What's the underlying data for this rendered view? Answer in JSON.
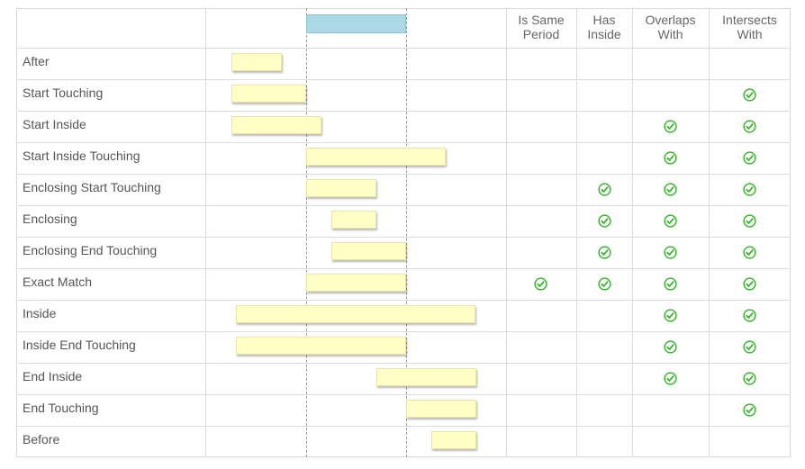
{
  "columns": [
    {
      "label_line1": "Is Same",
      "label_line2": "Period"
    },
    {
      "label_line1": "Has",
      "label_line2": "Inside"
    },
    {
      "label_line1": "Overlaps",
      "label_line2": "With"
    },
    {
      "label_line1": "Intersects",
      "label_line2": "With"
    }
  ],
  "rows": [
    {
      "label": "After",
      "checks": [
        false,
        false,
        false,
        false
      ]
    },
    {
      "label": "Start Touching",
      "checks": [
        false,
        false,
        false,
        true
      ]
    },
    {
      "label": "Start Inside",
      "checks": [
        false,
        false,
        true,
        true
      ]
    },
    {
      "label": "Start Inside Touching",
      "checks": [
        false,
        false,
        true,
        true
      ]
    },
    {
      "label": "Enclosing Start Touching",
      "checks": [
        false,
        true,
        true,
        true
      ]
    },
    {
      "label": "Enclosing",
      "checks": [
        false,
        true,
        true,
        true
      ]
    },
    {
      "label": "Enclosing End Touching",
      "checks": [
        false,
        true,
        true,
        true
      ]
    },
    {
      "label": "Exact Match",
      "checks": [
        true,
        true,
        true,
        true
      ]
    },
    {
      "label": "Inside",
      "checks": [
        false,
        false,
        true,
        true
      ]
    },
    {
      "label": "Inside End Touching",
      "checks": [
        false,
        false,
        true,
        true
      ]
    },
    {
      "label": "End Inside",
      "checks": [
        false,
        false,
        true,
        true
      ]
    },
    {
      "label": "End Touching",
      "checks": [
        false,
        false,
        false,
        true
      ]
    },
    {
      "label": "Before",
      "checks": [
        false,
        false,
        false,
        false
      ]
    }
  ],
  "reference_period": {
    "start": 0,
    "end": 10
  },
  "periods": [
    {
      "start": -7.5,
      "end": -2.5
    },
    {
      "start": -7.5,
      "end": 0
    },
    {
      "start": -7.5,
      "end": 1.5
    },
    {
      "start": 0,
      "end": 14
    },
    {
      "start": 0,
      "end": 7
    },
    {
      "start": 2.5,
      "end": 7
    },
    {
      "start": 2.5,
      "end": 10
    },
    {
      "start": 0,
      "end": 10
    },
    {
      "start": -7,
      "end": 17
    },
    {
      "start": -7,
      "end": 10
    },
    {
      "start": 7,
      "end": 17
    },
    {
      "start": 10,
      "end": 17
    },
    {
      "start": 12.5,
      "end": 17
    }
  ],
  "colors": {
    "reference_fill": "#add8e6",
    "period_fill": "#ffffc6",
    "check_green": "#3cb531"
  },
  "icons": {
    "check": "check-circle-icon"
  }
}
